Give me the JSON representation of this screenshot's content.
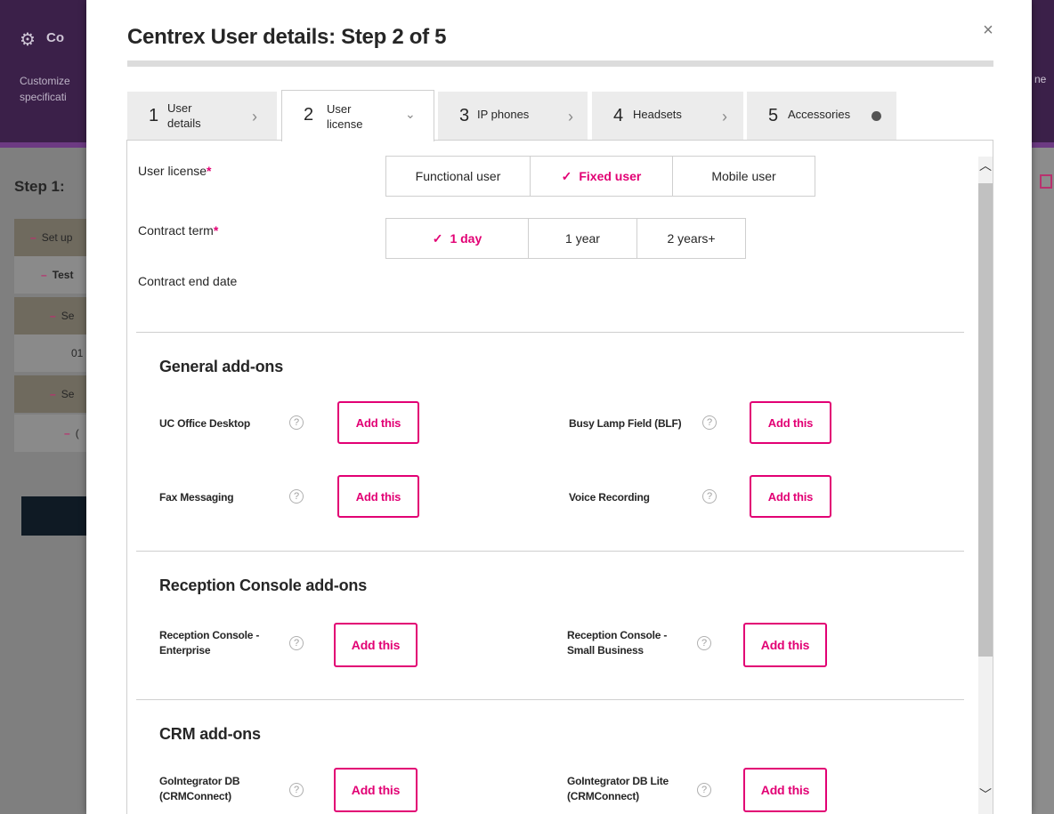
{
  "background": {
    "header_title": "Co",
    "header_subtitle_1": "Customize",
    "header_subtitle_2": "specificati",
    "step_title": "Step 1:",
    "rows": [
      "Set up",
      "Test",
      "Se",
      "01",
      "Se",
      "("
    ],
    "right_fragment": "ne"
  },
  "modal": {
    "title": "Centrex User details: Step 2 of 5",
    "close_label": "×"
  },
  "tabs": [
    {
      "num": "1",
      "label_1": "User",
      "label_2": "details"
    },
    {
      "num": "2",
      "label_1": "User",
      "label_2": "license"
    },
    {
      "num": "3",
      "label": "IP phones"
    },
    {
      "num": "4",
      "label": "Headsets"
    },
    {
      "num": "5",
      "label": "Accessories"
    }
  ],
  "user_license": {
    "label": "User license",
    "required": "*",
    "options": [
      "Functional user",
      "Fixed user",
      "Mobile user"
    ],
    "selected": "Fixed user"
  },
  "contract_term": {
    "label": "Contract term",
    "required": "*",
    "options": [
      "1 day",
      "1 year",
      "2 years+"
    ],
    "selected": "1 day"
  },
  "contract_end_date": {
    "label": "Contract end date"
  },
  "check_glyph": "✓",
  "help_glyph": "?",
  "add_label": "Add this",
  "sections": {
    "general": {
      "title": "General add-ons",
      "items": [
        "UC Office Desktop",
        "Busy Lamp Field (BLF)",
        "Fax Messaging",
        "Voice Recording"
      ]
    },
    "reception": {
      "title": "Reception Console add-ons",
      "items": [
        {
          "line1": "Reception Console -",
          "line2": "Enterprise"
        },
        {
          "line1": "Reception Console -",
          "line2": "Small Business"
        }
      ]
    },
    "crm": {
      "title": "CRM add-ons",
      "items": [
        {
          "line1": "GoIntegrator DB",
          "line2": "(CRMConnect)"
        },
        {
          "line1": "GoIntegrator DB Lite",
          "line2": "(CRMConnect)"
        }
      ]
    }
  },
  "colors": {
    "accent": "#e20074",
    "header_bg": "#3b2049"
  }
}
